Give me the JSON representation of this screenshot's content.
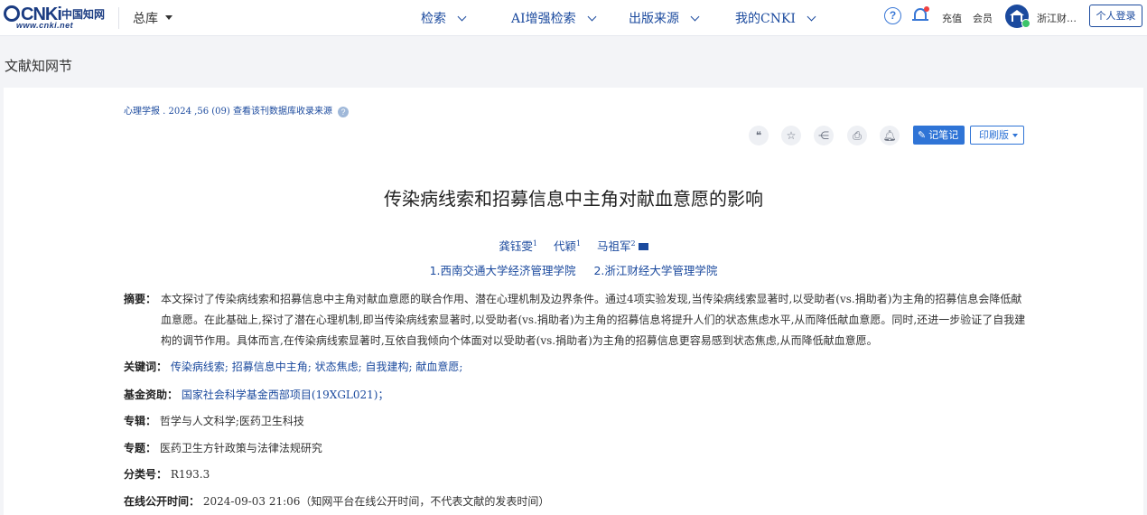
{
  "header": {
    "logo_mark": "CNKi",
    "logo_cn": "中国知网",
    "logo_url": "www.cnki.net",
    "zongku_label": "总库",
    "nav": [
      "检索",
      "AI增强检索",
      "出版来源",
      "我的CNKI"
    ],
    "help_label": "?",
    "recharge_label": "充值",
    "member_label": "会员",
    "user_name": "浙江财…",
    "login_label": "个人登录"
  },
  "page": {
    "section_title": "文献知网节"
  },
  "article": {
    "source_text": "心理学报 . 2024 ,56 (09)  查看该刊数据库收录来源",
    "toolbar": {
      "note_label": "记笔记",
      "print_label": "印刷版"
    },
    "title": "传染病线索和招募信息中主角对献血意愿的影响",
    "authors": [
      {
        "name": "龚钰雯",
        "sup": "1"
      },
      {
        "name": "代颖",
        "sup": "1"
      },
      {
        "name": "马祖军",
        "sup": "2"
      }
    ],
    "affiliations": [
      "1.西南交通大学经济管理学院",
      "2.浙江财经大学管理学院"
    ],
    "abstract_label": "摘要：",
    "abstract": "本文探讨了传染病线索和招募信息中主角对献血意愿的联合作用、潜在心理机制及边界条件。通过4项实验发现,当传染病线索显著时,以受助者(vs.捐助者)为主角的招募信息会降低献血意愿。在此基础上,探讨了潜在心理机制,即当传染病线索显著时,以受助者(vs.捐助者)为主角的招募信息将提升人们的状态焦虑水平,从而降低献血意愿。同时,还进一步验证了自我建构的调节作用。具体而言,在传染病线索显著时,互依自我倾向个体面对以受助者(vs.捐助者)为主角的招募信息更容易感到状态焦虑,从而降低献血意愿。",
    "keywords_label": "关键词：",
    "keywords": [
      "传染病线索;",
      "招募信息中主角;",
      "状态焦虑;",
      "自我建构;",
      "献血意愿;"
    ],
    "fund_label": "基金资助：",
    "fund": "国家社会科学基金西部项目(19XGL021)；",
    "series_label": "专辑：",
    "series": "哲学与人文科学;医药卫生科技",
    "topic_label": "专题：",
    "topic": "医药卫生方针政策与法律法规研究",
    "class_label": "分类号：",
    "class_no": "R193.3",
    "online_label": "在线公开时间：",
    "online_time": "2024-09-03 21:06（知网平台在线公开时间，不代表文献的发表时间）"
  }
}
